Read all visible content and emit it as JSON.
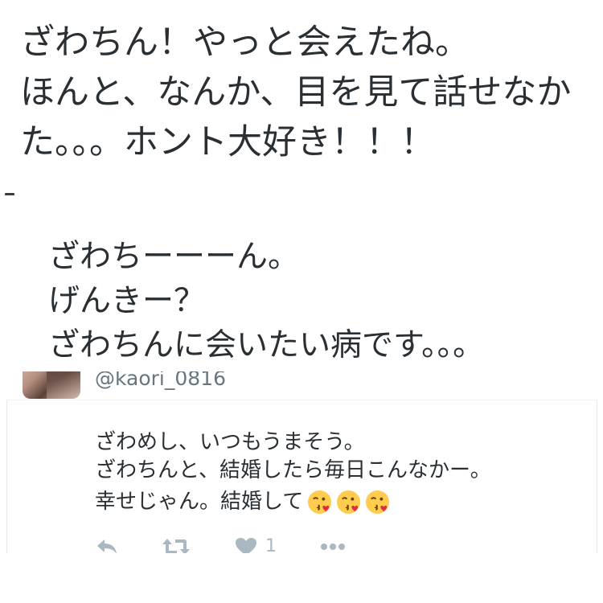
{
  "top_tweet": {
    "lines": [
      "ざわちん！やっと会えたね。",
      "ほんと、なんか、目を見て話せなか",
      "た。。。ホント大好き！！！"
    ]
  },
  "middle_tweet": {
    "lines": [
      "ざわちーーーん。",
      "げんきー？",
      "ざわちんに会いたい病です。。。"
    ]
  },
  "reply_tweet": {
    "handle": "@kaori_0816",
    "lines": [
      "ざわめし、いつもうまそう。",
      "ざわちんと、結婚したら毎日こんなかー。",
      "幸せじゃん。結婚して"
    ],
    "emoji": [
      "kissing-face-icon",
      "kissing-face-icon",
      "kissing-face-icon"
    ],
    "actions": {
      "reply_icon": "reply-icon",
      "retweet_icon": "retweet-icon",
      "like_icon": "heart-icon",
      "like_count": "1",
      "more_icon": "more-dots-icon"
    }
  },
  "colors": {
    "text": "#292f33",
    "secondary_text": "#66757f",
    "action_icons": "#aab8c2",
    "card_border": "#e1e8ed",
    "emoji_face": "#ffcc4d",
    "emoji_heart": "#dd2e44"
  }
}
